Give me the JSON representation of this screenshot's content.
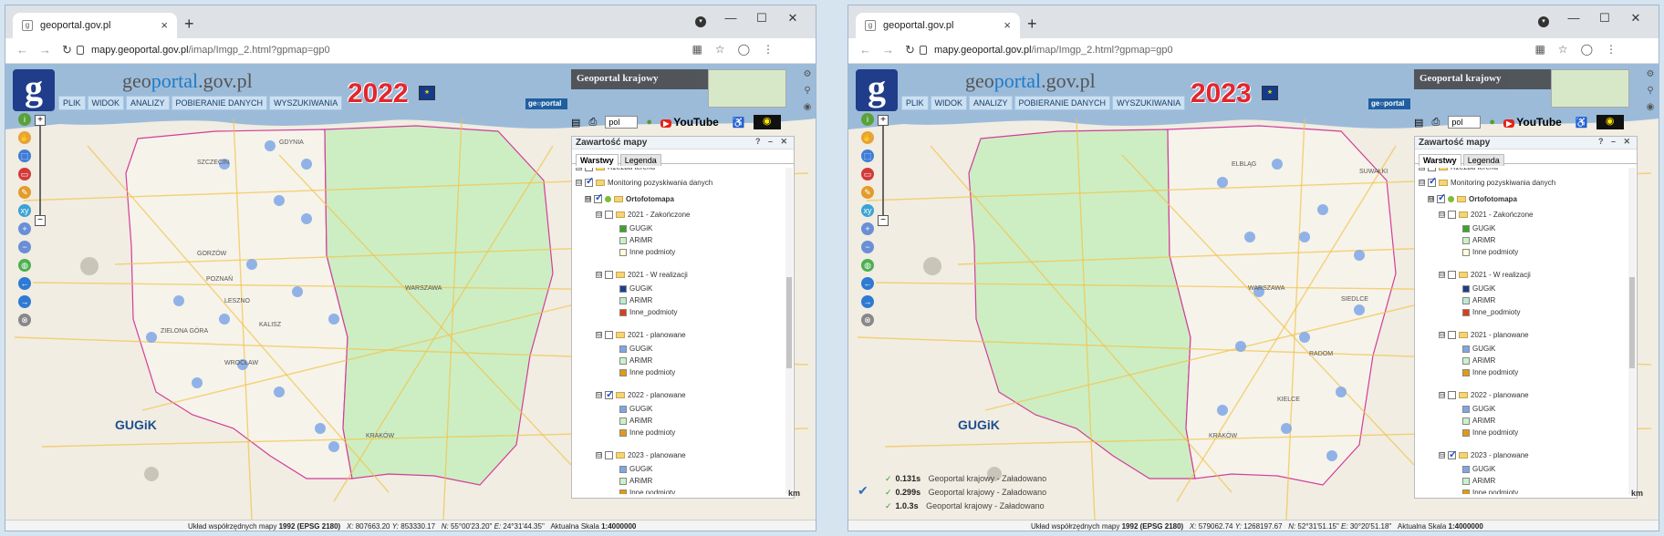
{
  "windows": [
    {
      "tab_title": "geoportal.gov.pl",
      "url_host": "mapy.geoportal.gov.pl",
      "url_path": "/imap/Imgp_2.html?gpmap=gp0",
      "year": "2022",
      "status": {
        "label": "Układ współrzędnych mapy",
        "crs": "1992 (EPSG 2180)",
        "x": "807663.20",
        "y": "853330.17",
        "n": "55°00'23.20\"",
        "e": "24°31'44.35\"",
        "scale_label": "Aktualna Skala",
        "scale": "1:4000000"
      },
      "checked_year": "2022",
      "loading": null
    },
    {
      "tab_title": "geoportal.gov.pl",
      "url_host": "mapy.geoportal.gov.pl",
      "url_path": "/imap/Imgp_2.html?gpmap=gp0",
      "year": "2023",
      "status": {
        "label": "Układ współrzędnych mapy",
        "crs": "1992 (EPSG 2180)",
        "x": "579062.74",
        "y": "1268197.67",
        "n": "52°31'51.15\"",
        "e": "30°20'51.18\"",
        "scale_label": "Aktualna Skala",
        "scale": "1:4000000"
      },
      "checked_year": "2023",
      "loading": [
        {
          "time": "0.131s",
          "text": "Geoportal krajowy - Załadowano"
        },
        {
          "time": "0.299s",
          "text": "Geoportal krajowy - Załadowano"
        },
        {
          "time": "1.0.3s",
          "text": "Geoportal krajowy - Załadowano"
        }
      ]
    }
  ],
  "brand": {
    "prefix": "geo",
    "mid": "portal",
    "suffix": ".gov.pl"
  },
  "menu": [
    "PLIK",
    "WIDOK",
    "ANALIZY",
    "POBIERANIE DANYCH",
    "WYSZUKIWANIA"
  ],
  "geoportal_krajowy": "Geoportal krajowy",
  "language": "pol",
  "youtube": "YouTube",
  "panel": {
    "title": "Zawartość mapy",
    "tabs": [
      "Warstwy",
      "Legenda"
    ],
    "top_cut": "Rzeźba terenu",
    "monitoring": "Monitoring pozyskiwania danych",
    "ortho": "Ortofotomapa",
    "groups": [
      {
        "label": "2021 - Zakończone",
        "items": [
          {
            "name": "GUGiK",
            "color": "#3aa626"
          },
          {
            "name": "ARiMR",
            "color": "#c9f2c4"
          },
          {
            "name": "Inne podmioty",
            "color": "#fffcd6"
          }
        ]
      },
      {
        "label": "2021 - W realizacji",
        "items": [
          {
            "name": "GUGiK",
            "color": "#1a3f8e"
          },
          {
            "name": "ARiMR",
            "color": "#b9ecd0"
          },
          {
            "name": "Inne_podmioty",
            "color": "#d8401c"
          }
        ]
      },
      {
        "label": "2021 - planowane",
        "items": [
          {
            "name": "GUGiK",
            "color": "#7ea6e6"
          },
          {
            "name": "ARiMR",
            "color": "#c8f3c8"
          },
          {
            "name": "Inne podmioty",
            "color": "#e29b10"
          }
        ]
      },
      {
        "label": "2022 - planowane",
        "items": [
          {
            "name": "GUGiK",
            "color": "#7ea6e6"
          },
          {
            "name": "ARiMR",
            "color": "#c8f3c8"
          },
          {
            "name": "Inne podmioty",
            "color": "#e29b10"
          }
        ]
      },
      {
        "label": "2023 - planowane",
        "items": [
          {
            "name": "GUGiK",
            "color": "#7ea6e6"
          },
          {
            "name": "ARiMR",
            "color": "#c8f3c8"
          },
          {
            "name": "Inne podmioty",
            "color": "#e29b10"
          }
        ]
      }
    ]
  },
  "map_labels": {
    "gugik": "GUGiK",
    "km": "km",
    "cities_2022": [
      "GDYNIA",
      "SZCZECIN",
      "POZNAŃ",
      "WROCŁAW",
      "ZIELONA GÓRA",
      "KALISZ",
      "WARSZAWA",
      "KRAKÓW",
      "GORZÓW",
      "LESZNO"
    ],
    "cities_2023": [
      "WARSZAWA",
      "RADOM",
      "KRAKÓW",
      "KIELCE",
      "SIEDLCE",
      "ELBLĄG",
      "SUWAŁKI"
    ]
  },
  "colors": {
    "planned_fill": "#cdeec3",
    "road": "#f2c34a",
    "water": "#7fa9d6",
    "orthophoto_blue": "#7ea6e6"
  }
}
